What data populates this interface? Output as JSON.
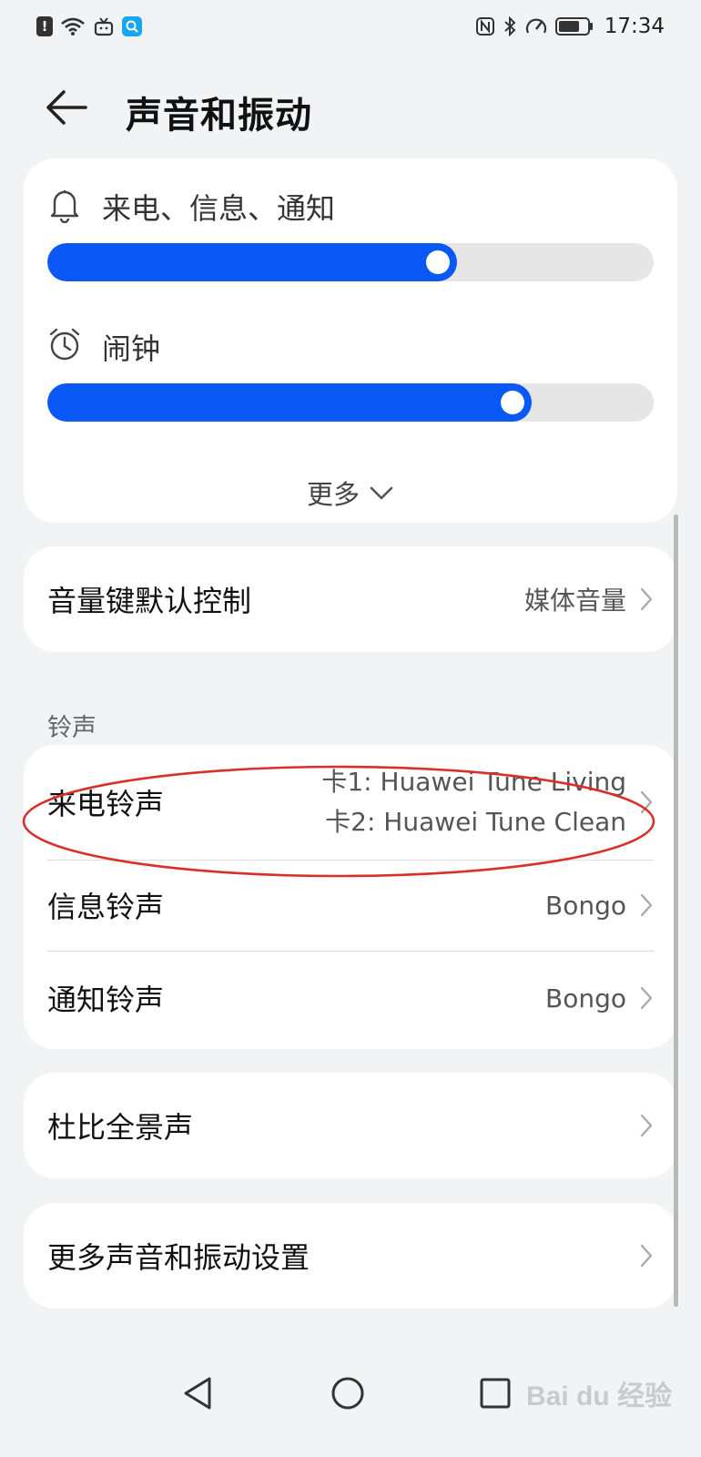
{
  "status_bar": {
    "time": "17:34",
    "left_icons": [
      "alert-icon",
      "wifi-icon",
      "tv-icon",
      "search-app-icon"
    ],
    "right_icons": [
      "nfc-icon",
      "bluetooth-icon",
      "speed-icon",
      "battery-icon"
    ]
  },
  "header": {
    "title": "声音和振动",
    "back_icon": "back-arrow-icon"
  },
  "volume": {
    "ring": {
      "label": "来电、信息、通知",
      "icon": "bell-icon",
      "level": 0.69
    },
    "alarm": {
      "label": "闹钟",
      "icon": "alarm-clock-icon",
      "level": 0.81
    },
    "more_label": "更多"
  },
  "volume_key": {
    "title": "音量键默认控制",
    "value": "媒体音量"
  },
  "ringtones": {
    "section_label": "铃声",
    "items": [
      {
        "title": "来电铃声",
        "values": [
          "卡1: Huawei Tune Living",
          "卡2: Huawei Tune Clean"
        ]
      },
      {
        "title": "信息铃声",
        "value": "Bongo"
      },
      {
        "title": "通知铃声",
        "value": "Bongo"
      }
    ]
  },
  "dolby": {
    "title": "杜比全景声"
  },
  "more_settings": {
    "title": "更多声音和振动设置"
  },
  "nav": [
    "back-triangle-icon",
    "home-circle-icon",
    "recents-square-icon"
  ],
  "watermark": "Bai du 经验",
  "colors": {
    "accent": "#0a59f7",
    "annotation": "#d9302a",
    "background": "#f1f3f5"
  }
}
